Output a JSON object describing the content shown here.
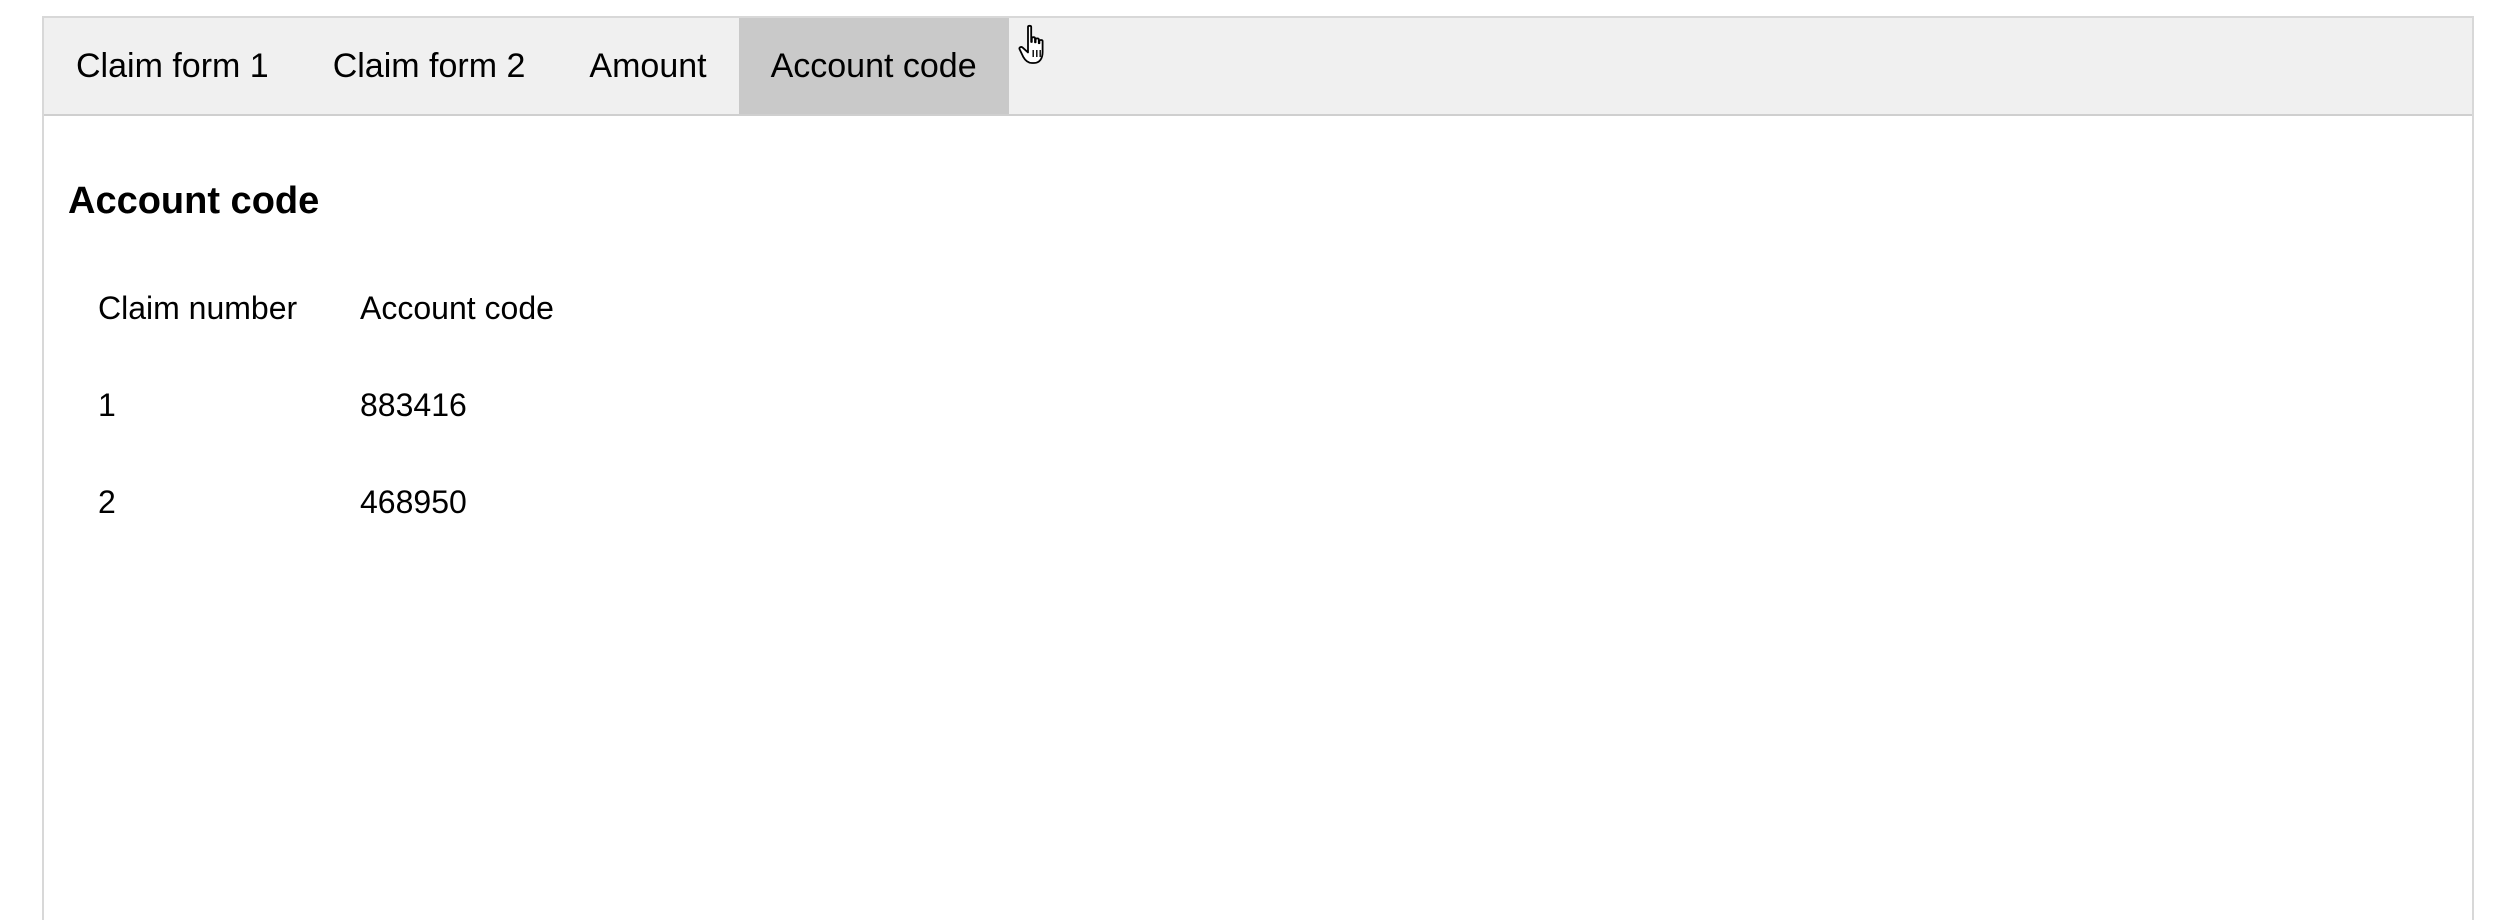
{
  "tabs": [
    {
      "label": "Claim form 1",
      "active": false
    },
    {
      "label": "Claim form 2",
      "active": false
    },
    {
      "label": "Amount",
      "active": false
    },
    {
      "label": "Account code",
      "active": true
    }
  ],
  "main": {
    "heading": "Account code",
    "table": {
      "headers": [
        "Claim number",
        "Account code"
      ],
      "rows": [
        [
          "1",
          "883416"
        ],
        [
          "2",
          "468950"
        ]
      ]
    }
  },
  "colors": {
    "tabbar_bg": "#f0f0f0",
    "active_tab_bg": "#c9c9c9",
    "border": "#d8d8d8"
  },
  "icons": {
    "cursor": "hand-pointer-icon"
  }
}
